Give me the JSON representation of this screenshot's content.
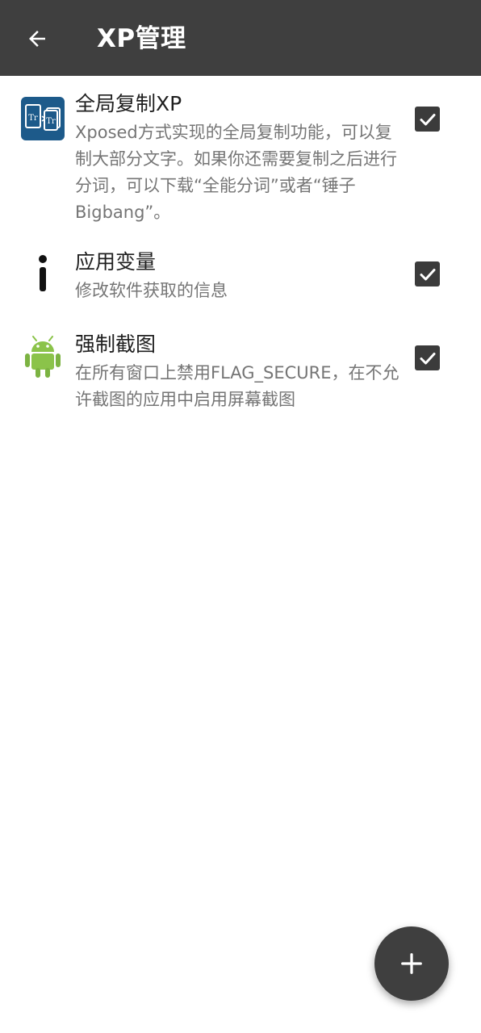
{
  "appbar": {
    "title": "XP管理",
    "back_icon": "arrow-left-icon"
  },
  "items": [
    {
      "title": "全局复制XP",
      "description": "Xposed方式实现的全局复制功能，可以复制大部分文字。如果你还需要复制之后进行分词，可以下载“全能分词”或者“锤子Bigbang”。",
      "icon": "text-copy-icon",
      "checked": true
    },
    {
      "title": "应用变量",
      "description": "修改软件获取的信息",
      "icon": "info-icon",
      "checked": true
    },
    {
      "title": "强制截图",
      "description": "在所有窗口上禁用FLAG_SECURE，在不允许截图的应用中启用屏幕截图",
      "icon": "android-icon",
      "checked": true
    }
  ],
  "fab": {
    "icon": "plus-icon"
  },
  "colors": {
    "appbar": "#3f3f3f",
    "checkbox": "#3b3b3b",
    "fab": "#3f3f3f",
    "copy_icon_bg": "#1d5a8a",
    "android_green": "#8bc34a"
  }
}
